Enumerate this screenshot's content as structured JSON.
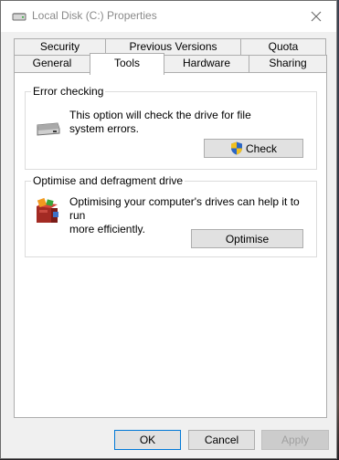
{
  "window": {
    "title": "Local Disk (C:) Properties",
    "close_glyph": "✕"
  },
  "tabs": {
    "row1": [
      "Security",
      "Previous Versions",
      "Quota"
    ],
    "row2": [
      "General",
      "Tools",
      "Hardware",
      "Sharing"
    ],
    "selected": "Tools"
  },
  "error_checking": {
    "title": "Error checking",
    "description_line1": "This option will check the drive for file",
    "description_line2": "system errors.",
    "button_label": "Check",
    "icon": "hard-drive-icon",
    "button_icon": "uac-shield-icon"
  },
  "optimise": {
    "title": "Optimise and defragment drive",
    "description_line1": "Optimising your computer's drives can help it to run",
    "description_line2": "more efficiently.",
    "button_label": "Optimise",
    "icon": "defragment-icon"
  },
  "footer": {
    "ok_label": "OK",
    "cancel_label": "Cancel",
    "apply_label": "Apply",
    "apply_enabled": false
  },
  "colors": {
    "window_bg": "#f0f0f0",
    "panel_bg": "#ffffff",
    "button_bg": "#e1e1e1",
    "title_text": "#8a8a8a",
    "default_button_border": "#0078d7"
  }
}
